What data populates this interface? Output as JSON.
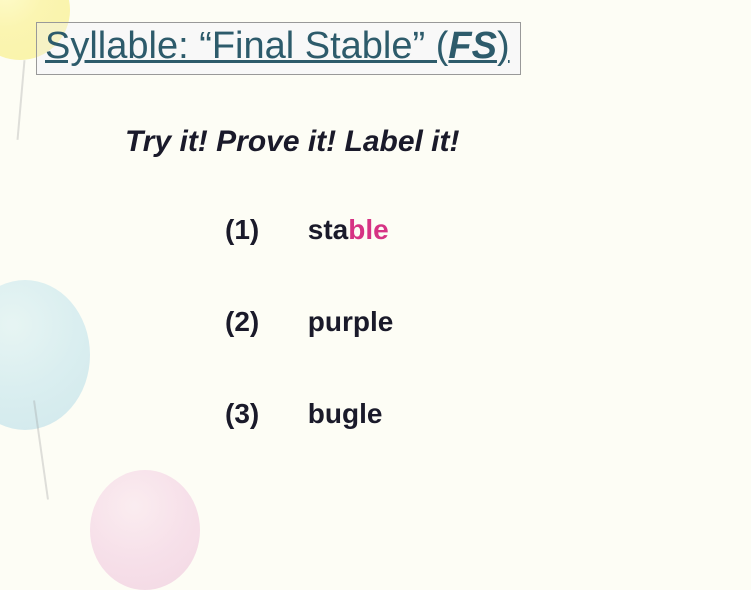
{
  "title": {
    "prefix": "Syllable:  “Final Stable” (",
    "fs": "FS",
    "suffix": ")"
  },
  "subtitle": "Try it!  Prove it! Label it!",
  "items": [
    {
      "num": "(1)",
      "word_prefix": "sta",
      "word_highlight": "ble",
      "word_suffix": ""
    },
    {
      "num": "(2)",
      "word_prefix": "purple",
      "word_highlight": "",
      "word_suffix": ""
    },
    {
      "num": "(3)",
      "word_prefix": "bugle",
      "word_highlight": "",
      "word_suffix": ""
    }
  ]
}
